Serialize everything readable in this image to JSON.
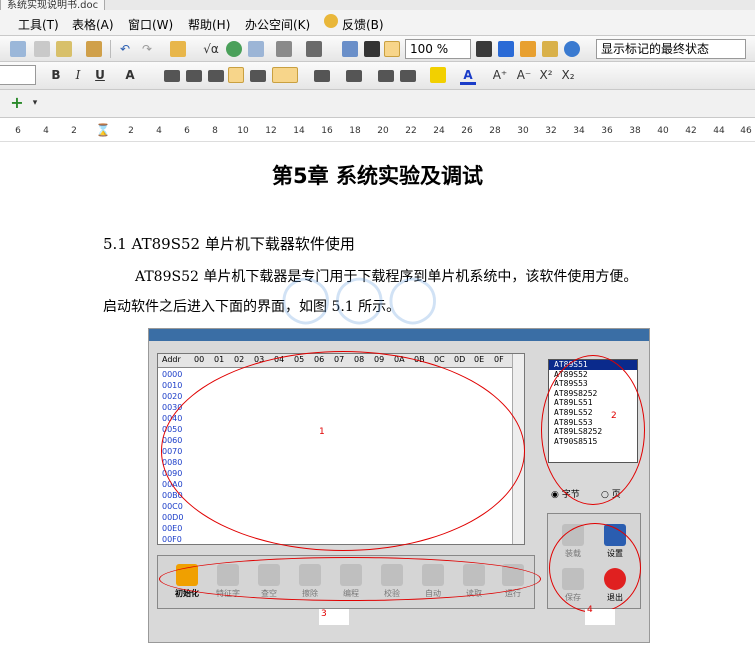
{
  "window": {
    "title": "系统实现说明书.doc"
  },
  "menu": [
    "工具(T)",
    "表格(A)",
    "窗口(W)",
    "帮助(H)",
    "办公空间(K)",
    "反馈(B)"
  ],
  "toolbar1": {
    "zoom": "100 %",
    "markup_state": "显示标记的最终状态"
  },
  "toolbar2": {
    "bold": "B",
    "italic": "I",
    "underline": "U",
    "font_color": "A",
    "grow": "A⁺",
    "shrink": "A⁻",
    "superscript": "X²",
    "subscript": "X₂"
  },
  "ruler": [
    "6",
    "4",
    "2",
    "2",
    "4",
    "6",
    "8",
    "10",
    "12",
    "14",
    "16",
    "18",
    "20",
    "22",
    "24",
    "26",
    "28",
    "30",
    "32",
    "34",
    "36",
    "38",
    "40",
    "42",
    "44",
    "46"
  ],
  "doc": {
    "chapter_title": "第5章  系统实验及调试",
    "section_title": "5.1 AT89S52 单片机下载器软件使用",
    "para_line1": "AT89S52 单片机下载器是专门用于下载程序到单片机系统中，该软件使用方便。",
    "para_line2": "启动软件之后进入下面的界面，如图 5.1 所示。"
  },
  "figure": {
    "hex_columns": [
      "Addr",
      "00",
      "01",
      "02",
      "03",
      "04",
      "05",
      "06",
      "07",
      "08",
      "09",
      "0A",
      "0B",
      "0C",
      "0D",
      "0E",
      "0F"
    ],
    "addresses": [
      "0000",
      "0010",
      "0020",
      "0030",
      "0040",
      "0050",
      "0060",
      "0070",
      "0080",
      "0090",
      "00A0",
      "00B0",
      "00C0",
      "00D0",
      "00E0",
      "00F0"
    ],
    "chips": [
      "AT89S51",
      "AT89S52",
      "AT89S53",
      "AT89S8252",
      "AT89LS51",
      "AT89LS52",
      "AT89LS53",
      "AT89LS8252",
      "AT90S8515"
    ],
    "radio_byte": "字节",
    "radio_page": "页",
    "tools": [
      "初始化",
      "特征字",
      "查空",
      "擦除",
      "编程",
      "校验",
      "自动",
      "读取",
      "运行"
    ],
    "right_tools": [
      "装载",
      "设置",
      "保存",
      "退出"
    ],
    "labels": [
      "1",
      "2",
      "3",
      "4"
    ]
  },
  "colors": {
    "accent": "#0a2a8c",
    "annotation": "#e00000",
    "hex_addr": "#1a3cc8"
  }
}
